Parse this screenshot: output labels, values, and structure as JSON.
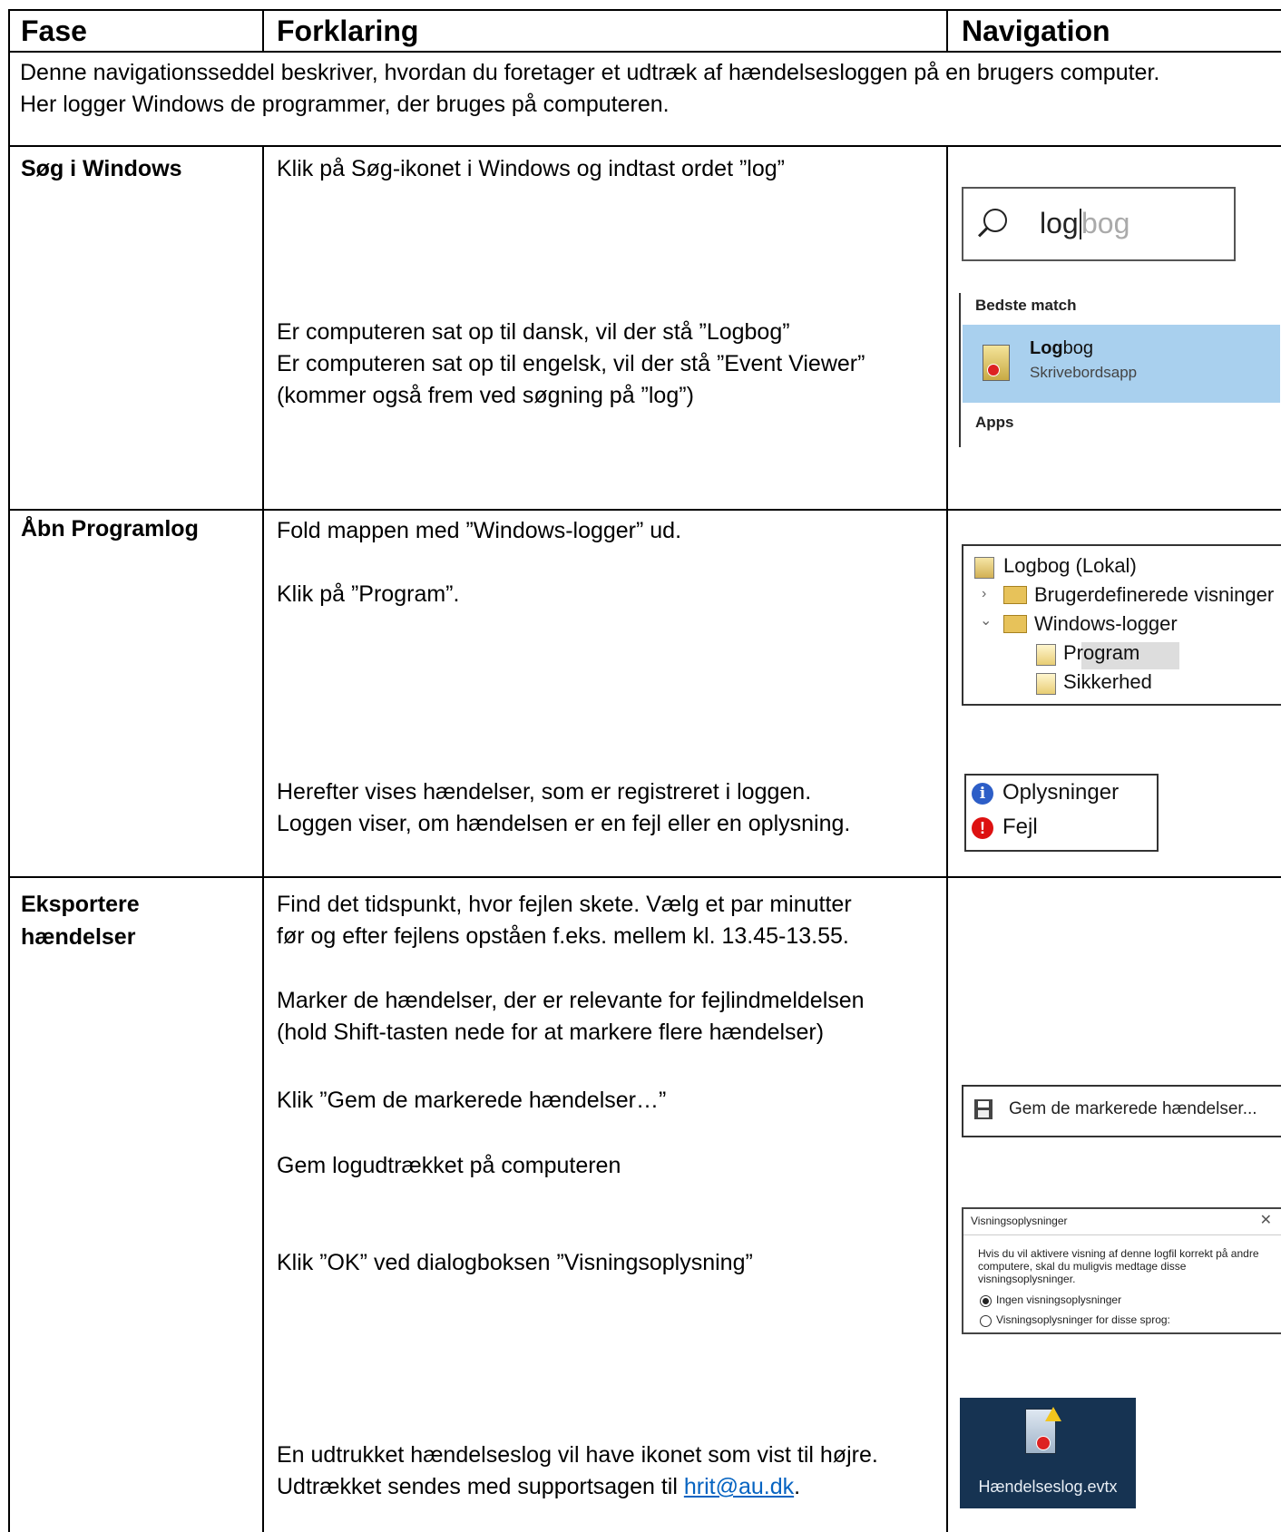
{
  "header": {
    "col_fase": "Fase",
    "col_forklaring": "Forklaring",
    "col_navigation": "Navigation"
  },
  "intro": {
    "line1": "Denne navigationsseddel beskriver, hvordan du foretager et udtræk af hændelsesloggen på en brugers computer.",
    "line2": "Her logger Windows de programmer, der bruges på computeren."
  },
  "rows": [
    {
      "fase": "Søg i Windows",
      "text": [
        "Klik på Søg-ikonet i Windows og indtast ordet ”log”",
        "Er computeren sat op til dansk, vil der stå ”Logbog”",
        "Er computeren sat op til engelsk, vil der stå ”Event Viewer”",
        "(kommer også frem ved søgning på ”log”)"
      ],
      "nav": {
        "search_query": "log",
        "search_hint": "bog",
        "best_match_label": "Bedste match",
        "app_name_bold": "Log",
        "app_name_rest": "bog",
        "app_sub": "Skrivebordsapp",
        "apps_label": "Apps",
        "icon": "search-icon"
      }
    },
    {
      "fase": "Åbn Programlog",
      "text": [
        "Fold mappen med ”Windows-logger” ud.",
        "Klik på ”Program”.",
        "Herefter vises hændelser, som er registreret i loggen.",
        "Loggen viser, om hændelsen er en fejl eller en oplysning."
      ],
      "nav": {
        "tree": [
          "Logbog (Lokal)",
          "Brugerdefinerede visninger",
          "Windows-logger",
          "Program",
          "Sikkerhed"
        ],
        "levels": [
          "Oplysninger",
          "Fejl"
        ]
      }
    },
    {
      "fase_line1": "Eksportere",
      "fase_line2": "hændelser",
      "text": [
        "Find det tidspunkt, hvor fejlen skete. Vælg et par minutter",
        "før og efter fejlens opståen f.eks. mellem kl. 13.45-13.55.",
        "Marker de hændelser, der er relevante for fejlindmeldelsen",
        "(hold Shift-tasten nede for at markere flere hændelser)",
        "Klik ”Gem de markerede hændelser…”",
        "Gem logudtrækket på computeren",
        "Klik ”OK” ved dialogboksen ”Visningsoplysning”",
        "En udtrukket hændelseslog vil have ikonet som vist til højre.",
        "Udtrækket sendes med supportsagen til "
      ],
      "email": "hrit@au.dk",
      "email_suffix": ".",
      "nav": {
        "save_label": "Gem de markerede hændelser...",
        "dialog_title": "Visningsoplysninger",
        "dialog_close": "✕",
        "dialog_body": "Hvis du vil aktivere visning af denne logfil korrekt på andre computere, skal du muligvis medtage disse visningsoplysninger.",
        "dialog_opt1": "Ingen visningsoplysninger",
        "dialog_opt2": "Visningsoplysninger for disse sprog:",
        "file_name": "Hændelseslog.evtx"
      }
    }
  ]
}
